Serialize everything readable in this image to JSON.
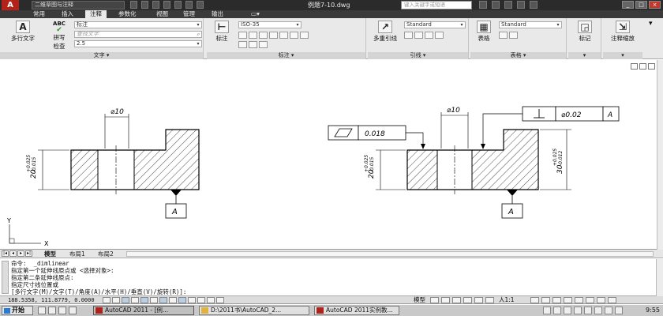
{
  "titlebar": {
    "logo": "A",
    "workspace": "二维草图与注释",
    "doc_title": "例题7-10.dwg",
    "search_placeholder": "键入关键字或短语"
  },
  "ribbon_tabs": [
    "常用",
    "插入",
    "注释",
    "参数化",
    "视图",
    "管理",
    "输出"
  ],
  "ribbon_tab_active": 2,
  "ribbon": {
    "text_panel": {
      "title": "文字",
      "mtext_label": "多行文字",
      "spell_label_line1": "拼写",
      "spell_label_line2": "检查",
      "abc_label": "ABC",
      "style_value": "标注",
      "find_placeholder": "查找文字",
      "height_value": "2.5"
    },
    "dim_panel": {
      "title": "标注",
      "dim_label": "标注",
      "style_value": "ISO-35"
    },
    "leader_panel": {
      "title": "引线",
      "mleader_label": "多重引线",
      "style_value": "Standard"
    },
    "table_panel": {
      "title": "表格",
      "table_label": "表格",
      "style_value": "Standard"
    },
    "markup_panel": {
      "label": "标记"
    },
    "scale_panel": {
      "label": "注释缩放"
    }
  },
  "drawing": {
    "left_view": {
      "dia_label": "⌀10",
      "height_label": "20",
      "tol_upper": "+0.025",
      "tol_lower": "-0.015",
      "datum": "A"
    },
    "right_view": {
      "dia_label": "⌀10",
      "height_label": "20",
      "tol_upper": "+0.025",
      "tol_lower": "-0.015",
      "height2_label": "30",
      "tol2_upper": "+0.025",
      "tol2_lower": "-0.012",
      "flatness_value": "0.018",
      "perp_value": "⌀0.02",
      "perp_datum": "A",
      "datum": "A"
    },
    "ucs_x": "X",
    "ucs_y": "Y"
  },
  "layout_tabs": [
    "模型",
    "布局1",
    "布局2"
  ],
  "command_lines": [
    "命令:  _dimlinear",
    "指定第一个延伸线原点或 <选择对象>:",
    "指定第二条延伸线原点:",
    "指定尺寸线位置或",
    "[多行文字(M)/文字(T)/角度(A)/水平(H)/垂直(V)/旋转(R)]:"
  ],
  "status": {
    "coords": "188.5358, 111.8779, 0.0000",
    "model_label": "模型",
    "scale_label": "人1:1"
  },
  "taskbar": {
    "start_label": "开始",
    "tasks": [
      "AutoCAD 2011 - [例...",
      "D:\\2011书\\AutoCAD_2...",
      "AutoCAD 2011实例教..."
    ],
    "clock": "9:55"
  }
}
